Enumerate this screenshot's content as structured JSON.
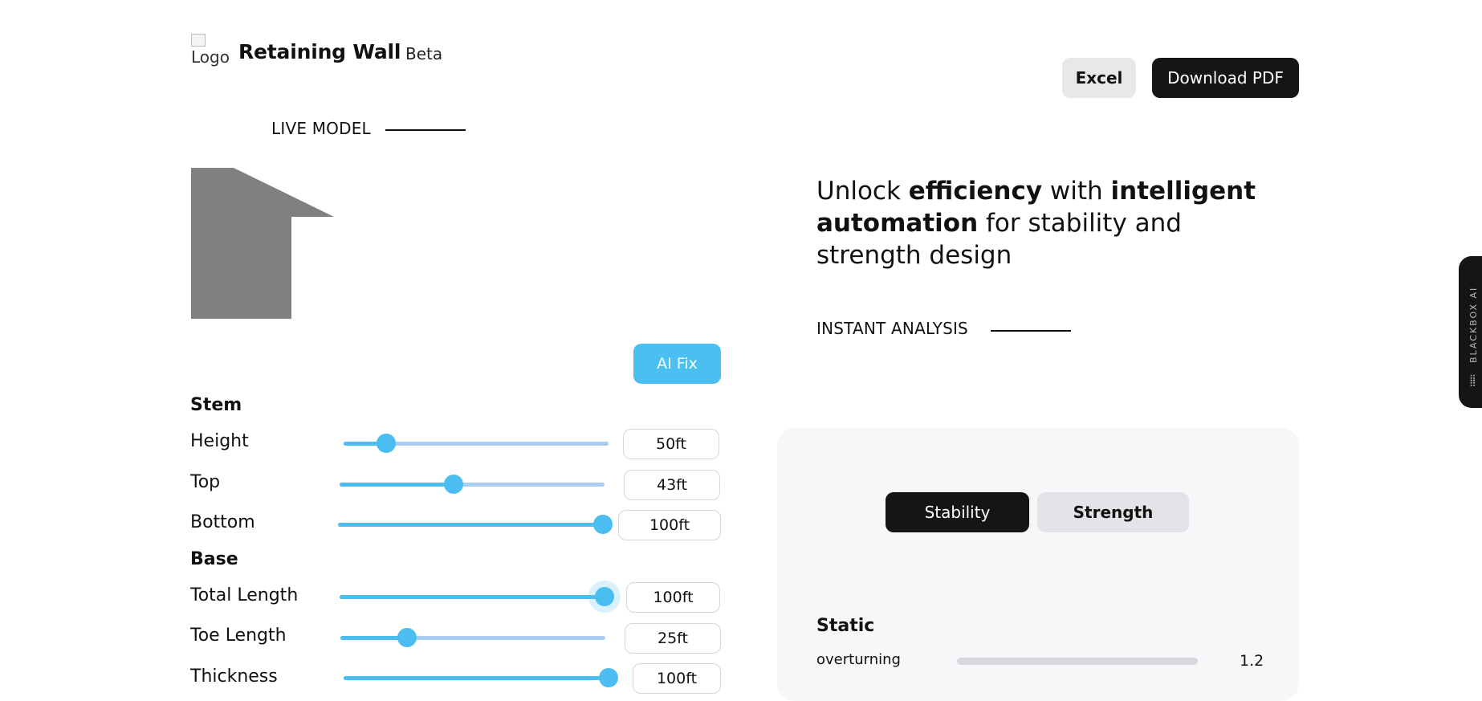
{
  "header": {
    "logo_alt": "Logo",
    "title": "Retaining Wall",
    "badge": "Beta",
    "excel_label": "Excel",
    "pdf_label": "Download PDF"
  },
  "live_model": {
    "label": "LIVE MODEL",
    "shape_color": "#808080"
  },
  "ai_fix_label": "AI Fix",
  "controls": {
    "stem": {
      "heading": "Stem",
      "rows": [
        {
          "label": "Height",
          "value": "50ft",
          "percent": 16
        },
        {
          "label": "Top",
          "value": "43ft",
          "percent": 43
        },
        {
          "label": "Bottom",
          "value": "100ft",
          "percent": 100
        }
      ]
    },
    "base": {
      "heading": "Base",
      "rows": [
        {
          "label": "Total Length",
          "value": "100ft",
          "percent": 100
        },
        {
          "label": "Toe Length",
          "value": "25ft",
          "percent": 25
        },
        {
          "label": "Thickness",
          "value": "100ft",
          "percent": 100
        }
      ]
    }
  },
  "hero": {
    "t1": "Unlock ",
    "b1": "efficiency",
    "t2": " with ",
    "b2": "intelligent automation",
    "t3": " for stability and strength design"
  },
  "instant_analysis_label": "INSTANT ANALYSIS",
  "tabs": {
    "stability": "Stability",
    "strength": "Strength",
    "active": "stability"
  },
  "analysis": {
    "heading": "Static",
    "metrics": [
      {
        "label": "overturning",
        "value": "1.2"
      }
    ]
  },
  "side_tab_label": "BLACKBOX AI",
  "colors": {
    "accent": "#4cbdf1",
    "track": "#a9cdf1",
    "dark": "#151515"
  }
}
